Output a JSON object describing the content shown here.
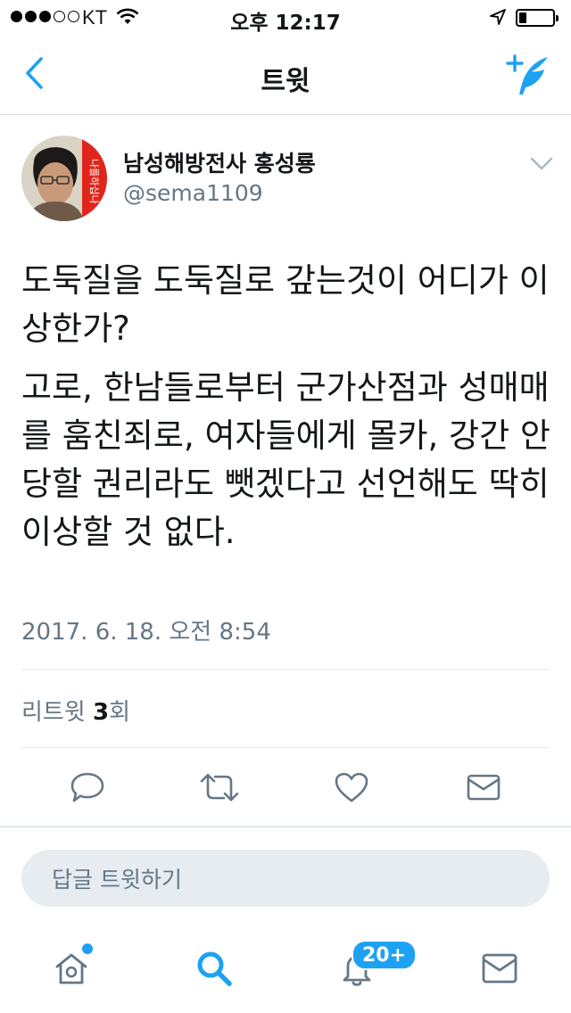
{
  "status_bar": {
    "carrier": "KT",
    "time": "오후 12:17",
    "signal_dots_filled": 3,
    "signal_dots_total": 5,
    "battery_level": 0.15
  },
  "nav": {
    "title": "트윗",
    "back_icon": "chevron-left-icon",
    "compose_icon": "compose-tweet-icon"
  },
  "tweet": {
    "author_name": "남성해방전사 홍성룡",
    "author_handle": "@sema1109",
    "paragraphs": [
      "도둑질을 도둑질로 갚는것이 어디가 이상한가?",
      "고로, 한남들로부터 군가산점과 성매매를 훔친죄로, 여자들에게 몰카, 강간 안당할 권리라도 뺏겠다고 선언해도 딱히 이상할 것 없다."
    ],
    "timestamp": "2017. 6. 18. 오전 8:54",
    "retweet_label": "리트윗",
    "retweet_count": "3",
    "retweet_suffix": "회"
  },
  "actions": [
    "reply-icon",
    "retweet-icon",
    "like-icon",
    "message-icon"
  ],
  "reply_box": {
    "placeholder": "답글 트윗하기"
  },
  "tab_bar": {
    "items": [
      "home-icon",
      "search-icon",
      "notifications-icon",
      "messages-icon"
    ],
    "notifications_badge": "20+"
  },
  "colors": {
    "accent": "#1da1f2",
    "secondary_text": "#657786",
    "divider": "#e1e8ed"
  }
}
